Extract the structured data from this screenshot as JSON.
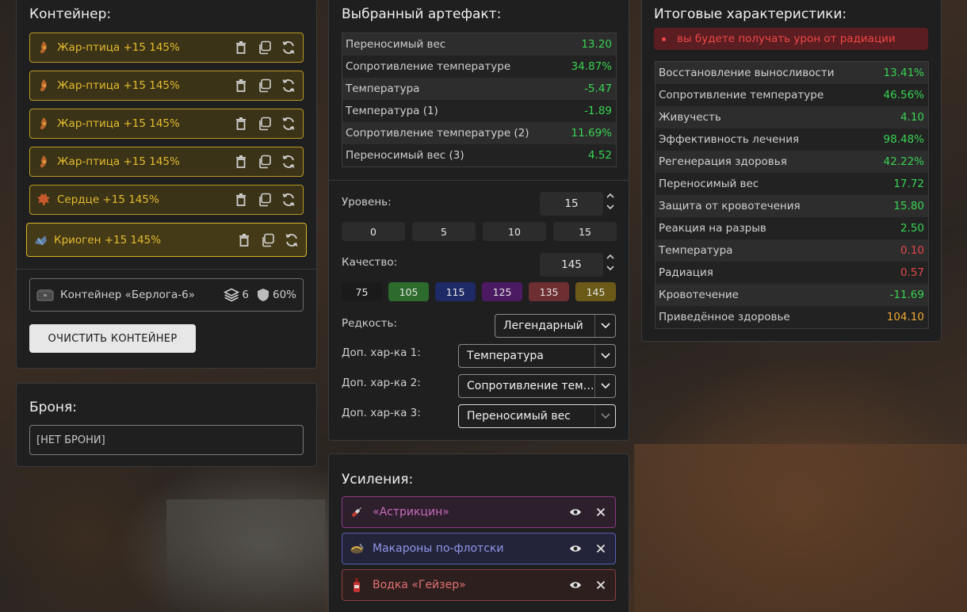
{
  "container": {
    "title": "Контейнер:",
    "items": [
      {
        "name": "Жар-птица +15 145%",
        "icon": "firebird-icon"
      },
      {
        "name": "Жар-птица +15 145%",
        "icon": "firebird-icon"
      },
      {
        "name": "Жар-птица +15 145%",
        "icon": "firebird-icon"
      },
      {
        "name": "Жар-птица +15 145%",
        "icon": "firebird-icon"
      },
      {
        "name": "Сердце +15 145%",
        "icon": "heart-artifact-icon"
      },
      {
        "name": "Криоген +15 145%",
        "icon": "cryogen-icon"
      }
    ],
    "box_name": "Контейнер «Берлога-6»",
    "box_slots": "6",
    "box_protection": "60%",
    "clear_button": "ОЧИСТИТЬ КОНТЕЙНЕР"
  },
  "armor": {
    "title": "Броня:",
    "value": "[НЕТ БРОНИ]"
  },
  "selected": {
    "title": "Выбранный артефакт:",
    "stats": [
      {
        "name": "Переносимый вес",
        "value": "13.20",
        "tone": "pos"
      },
      {
        "name": "Сопротивление температуре",
        "value": "34.87%",
        "tone": "pos"
      },
      {
        "name": "Температура",
        "value": "-5.47",
        "tone": "pos"
      },
      {
        "name": "Температура (1)",
        "value": "-1.89",
        "tone": "pos"
      },
      {
        "name": "Сопротивление температуре (2)",
        "value": "11.69%",
        "tone": "pos"
      },
      {
        "name": "Переносимый вес (3)",
        "value": "4.52",
        "tone": "pos"
      }
    ],
    "level_label": "Уровень:",
    "level_value": "15",
    "level_presets": [
      "0",
      "5",
      "10",
      "15"
    ],
    "quality_label": "Качество:",
    "quality_value": "145",
    "quality_presets": [
      {
        "label": "75",
        "color": "#1a1a1a"
      },
      {
        "label": "105",
        "color": "#2d6a2d"
      },
      {
        "label": "115",
        "color": "#1e2a66"
      },
      {
        "label": "125",
        "color": "#4b1a63"
      },
      {
        "label": "135",
        "color": "#6e2f33"
      },
      {
        "label": "145",
        "color": "#6b5a17"
      }
    ],
    "rarity_label": "Редкость:",
    "rarity_value": "Легендарный",
    "extra1_label": "Доп. хар-ка 1:",
    "extra1_value": "Температура",
    "extra2_label": "Доп. хар-ка 2:",
    "extra2_value": "Сопротивление температуре",
    "extra3_label": "Доп. хар-ка 3:",
    "extra3_value": "Переносимый вес"
  },
  "boosts": {
    "title": "Усиления:",
    "items": [
      {
        "name": "«Астрикцин»",
        "color": "#c76bb8",
        "border": "#8a3b7e",
        "bg": "#2e1f2d",
        "icon": "syringe-icon"
      },
      {
        "name": "Макароны по-флотски",
        "color": "#8f96e8",
        "border": "#575fae",
        "bg": "#23243a",
        "icon": "pasta-icon"
      },
      {
        "name": "Водка «Гейзер»",
        "color": "#e07070",
        "border": "#8a3f3f",
        "bg": "#2e1f1f",
        "icon": "bottle-icon"
      }
    ]
  },
  "summary": {
    "title": "Итоговые характеристики:",
    "warning": "вы будете получать урон от радиации",
    "stats": [
      {
        "name": "Восстановление выносливости",
        "value": "13.41%",
        "tone": "pos"
      },
      {
        "name": "Сопротивление температуре",
        "value": "46.56%",
        "tone": "pos"
      },
      {
        "name": "Живучесть",
        "value": "4.10",
        "tone": "pos"
      },
      {
        "name": "Эффективность лечения",
        "value": "98.48%",
        "tone": "pos"
      },
      {
        "name": "Регенерация здоровья",
        "value": "42.22%",
        "tone": "pos"
      },
      {
        "name": "Переносимый вес",
        "value": "17.72",
        "tone": "pos"
      },
      {
        "name": "Защита от кровотечения",
        "value": "15.80",
        "tone": "pos"
      },
      {
        "name": "Реакция на разрыв",
        "value": "2.50",
        "tone": "pos"
      },
      {
        "name": "Температура",
        "value": "0.10",
        "tone": "neg"
      },
      {
        "name": "Радиация",
        "value": "0.57",
        "tone": "neg"
      },
      {
        "name": "Кровотечение",
        "value": "-11.69",
        "tone": "pos"
      },
      {
        "name": "Приведённое здоровье",
        "value": "104.10",
        "tone": "warn"
      }
    ]
  }
}
